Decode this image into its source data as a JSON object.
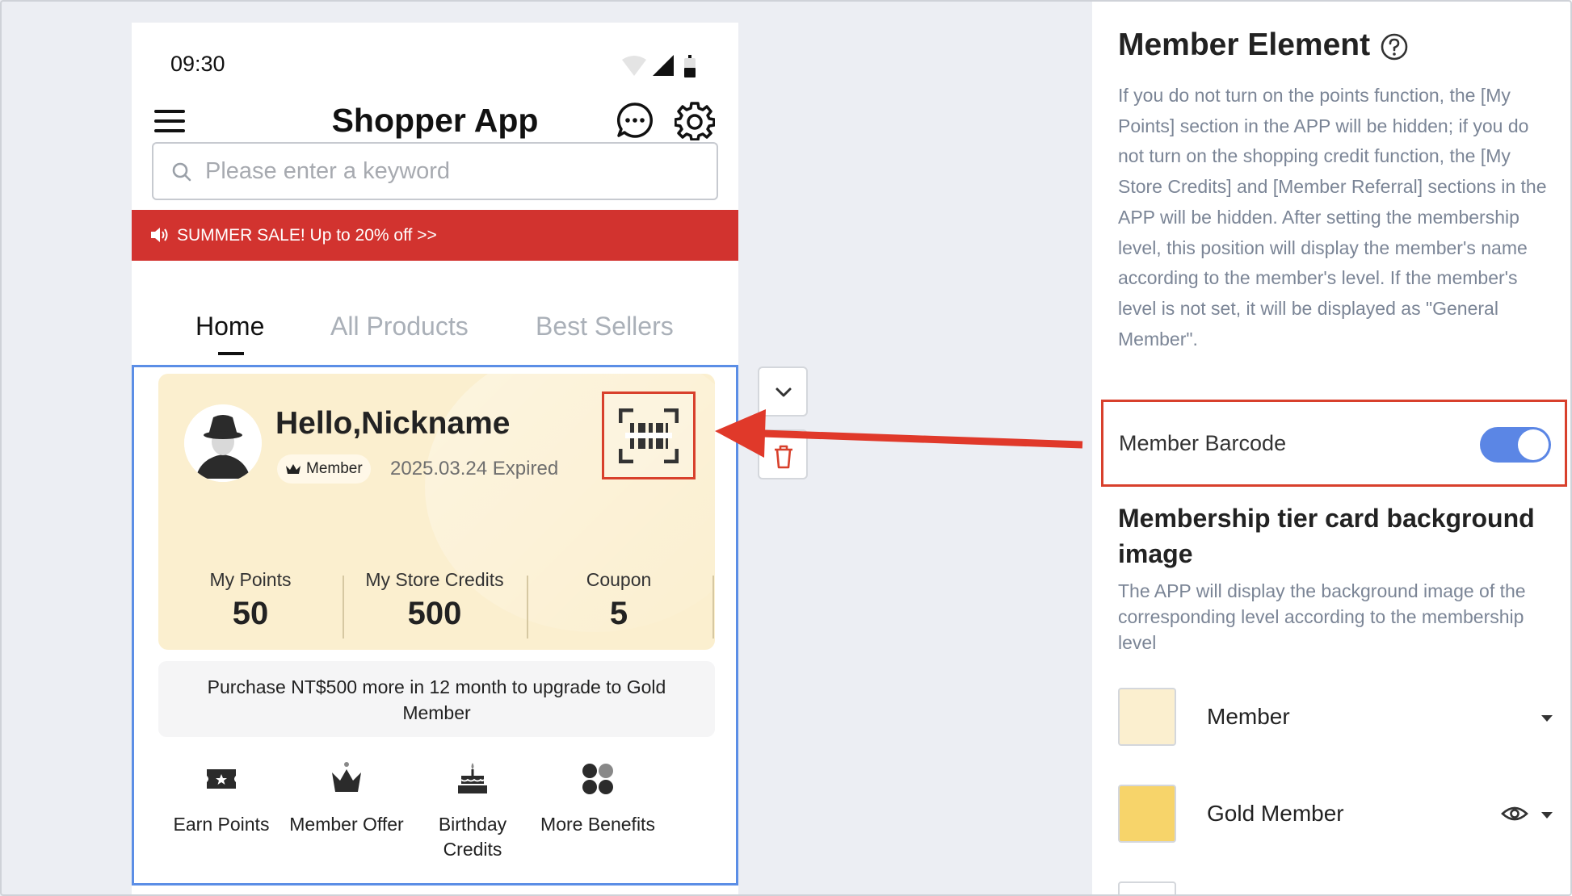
{
  "phone": {
    "status_time": "09:30",
    "app_title": "Shopper App",
    "search_placeholder": "Please enter a keyword",
    "sale_banner": "SUMMER SALE! Up to 20% off >>",
    "tabs": [
      {
        "label": "Home",
        "active": true
      },
      {
        "label": "All Products",
        "active": false
      },
      {
        "label": "Best Sellers",
        "active": false
      }
    ]
  },
  "member_card": {
    "greeting": "Hello,Nickname",
    "tier_badge": "Member",
    "expiry": "2025.03.24 Expired",
    "stats": [
      {
        "label": "My Points",
        "value": "50"
      },
      {
        "label": "My Store Credits",
        "value": "500"
      },
      {
        "label": "Coupon",
        "value": "5"
      }
    ],
    "upgrade_text": "Purchase NT$500 more in 12 month to upgrade to Gold Member",
    "benefits": [
      {
        "label": "Earn Points",
        "icon": "ticket-star-icon"
      },
      {
        "label": "Member Offer",
        "icon": "crown-icon"
      },
      {
        "label": "Birthday Credits",
        "icon": "cake-icon"
      },
      {
        "label": "More Benefits",
        "icon": "four-leaf-icon"
      }
    ],
    "card_color": "#fbefcf"
  },
  "panel": {
    "title": "Member Element",
    "description": "If you do not turn on the points function, the [My Points] section in the APP will be hidden; if you do not turn on the shopping credit function, the [My Store Credits] and [Member Referral] sections in the APP will be hidden. After setting the membership level, this position will display the member's name according to the member's level. If the member's level is not set, it will be displayed as \"General Member\".",
    "barcode_label": "Member Barcode",
    "barcode_enabled": true,
    "bg_title": "Membership tier card background image",
    "bg_description": "The APP will display the background image of the corresponding level according to the membership level",
    "tiers": [
      {
        "name": "Member",
        "color": "#fbefcf"
      },
      {
        "name": "Gold Member",
        "color": "#f7d46a"
      }
    ]
  },
  "colors": {
    "accent_red": "#d2332f",
    "highlight_red": "#d8402c",
    "selection_blue": "#5b8ee6",
    "toggle_blue": "#5b86e5"
  }
}
